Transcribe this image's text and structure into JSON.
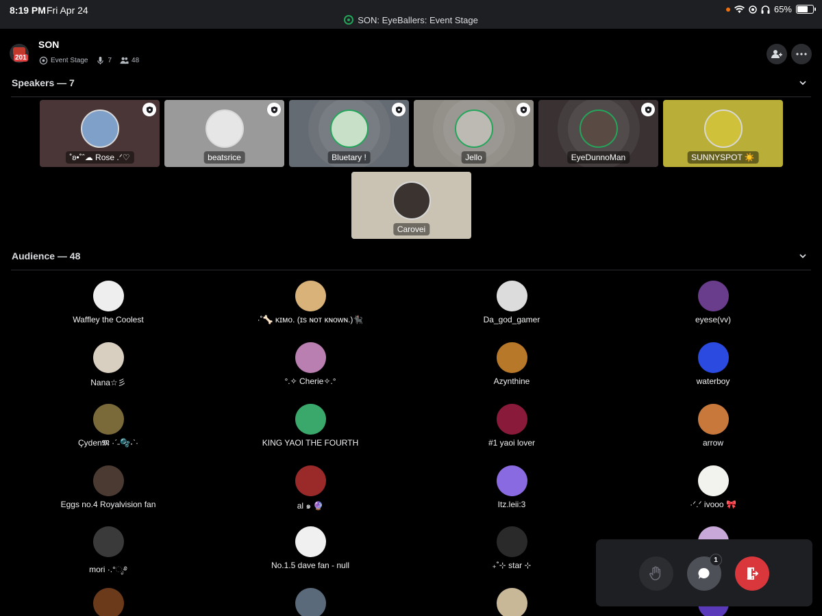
{
  "status_bar": {
    "time": "8:19 PM",
    "date": "Fri Apr 24",
    "stage_server": "SON:",
    "stage_text": "EyeBallers: Event Stage",
    "battery": "65%"
  },
  "header": {
    "server_badge": "201",
    "channel_name": "SON",
    "stage_label": "Event Stage",
    "speaker_count": "7",
    "listener_count": "48"
  },
  "sections": {
    "speakers": "Speakers — 7",
    "audience": "Audience — 48"
  },
  "speakers": [
    {
      "name": "˚ʚ•˚ˆ☁︎ Rose .ᐟ♡",
      "bg": "#4a3636",
      "av": "#7fa0c8",
      "moderator": true
    },
    {
      "name": "beatsrice",
      "bg": "#9a9a9a",
      "av": "#e6e6e6",
      "moderator": true
    },
    {
      "name": "Bluetary !",
      "bg": "#656b72",
      "av": "#c8e0c8",
      "moderator": true
    },
    {
      "name": "Jello",
      "bg": "#8e8b84",
      "av": "#bcbab2",
      "moderator": true
    },
    {
      "name": "EyeDunnoMan",
      "bg": "#3a3232",
      "av": "#5a4a44",
      "moderator": true
    },
    {
      "name": "SUNNYSPOT ☀️",
      "bg": "#b8ae38",
      "av": "#cfc23a",
      "moderator": false
    },
    {
      "name": "Carovei",
      "bg": "#cac3b3",
      "av": "#3a3330",
      "moderator": false
    }
  ],
  "audience": [
    {
      "name": "Waffley the Coolest",
      "av": "#eeeeee"
    },
    {
      "name": "·˚🦴 ᴋɪᴍᴏ. (ɪs ɴᴏᴛ ᴋɴᴏᴡɴ.)🐈‍⬛",
      "av": "#d9b27a"
    },
    {
      "name": "Da_god_gamer",
      "av": "#dcdcdc"
    },
    {
      "name": "eyese(vv)",
      "av": "#6a3c8c"
    },
    {
      "name": "Nana☆彡",
      "av": "#d8cfc0"
    },
    {
      "name": "°.✧ Cherie✧.°",
      "av": "#b97fb0"
    },
    {
      "name": "Azynthine",
      "av": "#b8782a"
    },
    {
      "name": "waterboy",
      "av": "#2a4ae0"
    },
    {
      "name": "Çyden𝕸 ·ˊ˗🫧˖ˋ·",
      "av": "#7a6a3a"
    },
    {
      "name": "KING YAOI THE FOURTH",
      "av": "#3aa86a"
    },
    {
      "name": "#1 yaoi lover",
      "av": "#8a1a3a"
    },
    {
      "name": "arrow",
      "av": "#c8783a"
    },
    {
      "name": "Eggs no.4 Royalvision fan",
      "av": "#4a3a32"
    },
    {
      "name": "al ๑ 🔮",
      "av": "#9a2a2a"
    },
    {
      "name": "Itz.leii:3",
      "av": "#8a6ae0"
    },
    {
      "name": "·ᐟ.ᐟ ivooo 🎀",
      "av": "#f2f2ee"
    },
    {
      "name": "mori ·.°ೃ࿔",
      "av": "#3a3a3a"
    },
    {
      "name": "No.1.5 dave fan - null",
      "av": "#f0f0f0"
    },
    {
      "name": "₊˚⊹ star ⊹",
      "av": "#2a2a2a"
    },
    {
      "name": "",
      "av": "#c8a8d8"
    },
    {
      "name": "",
      "av": "#6a3a1a"
    },
    {
      "name": "",
      "av": "#5a6a7a"
    },
    {
      "name": "",
      "av": "#c8b898"
    },
    {
      "name": "",
      "av": "#5a3ab8"
    }
  ],
  "controls": {
    "chat_unread": "1"
  }
}
